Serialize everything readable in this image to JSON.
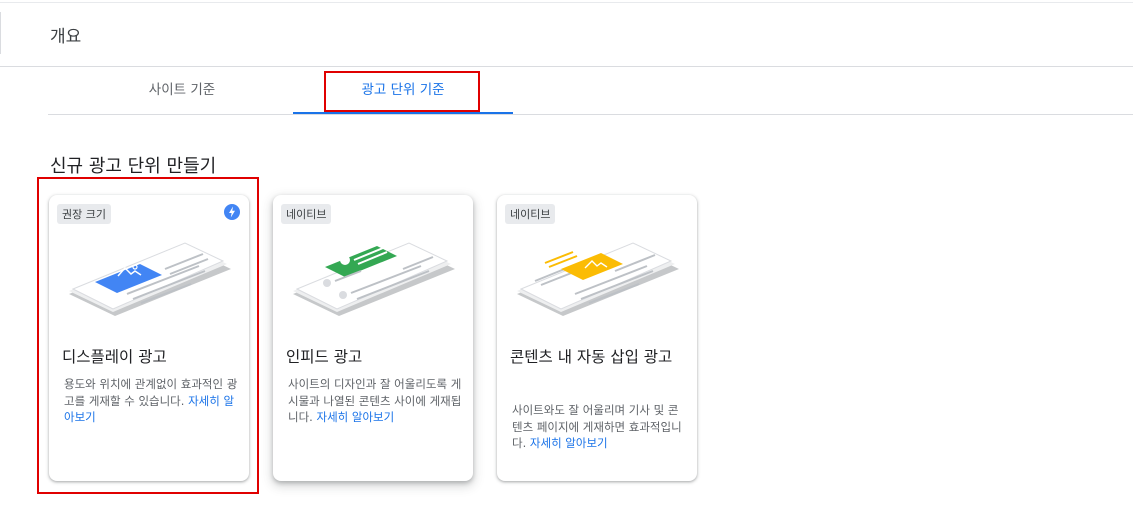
{
  "header": {
    "title": "개요"
  },
  "tabs": [
    {
      "label": "사이트 기준"
    },
    {
      "label": "광고 단위 기준"
    }
  ],
  "section": {
    "title": "신규 광고 단위 만들기"
  },
  "cards": [
    {
      "badge": "권장 크기",
      "title": "디스플레이 광고",
      "description": "용도와 위치에 관계없이 효과적인 광고를 게재할 수 있습니다.",
      "link": "자세히 알아보기",
      "icon": "display-ad-illustration",
      "accent": "#4285f4"
    },
    {
      "badge": "네이티브",
      "title": "인피드 광고",
      "description": "사이트의 디자인과 잘 어울리도록 게시물과 나열된 콘텐츠 사이에 게재됩니다.",
      "link": "자세히 알아보기",
      "icon": "infeed-ad-illustration",
      "accent": "#34a853"
    },
    {
      "badge": "네이티브",
      "title": "콘텐츠 내 자동 삽입 광고",
      "description": "사이트와도 잘 어울리며 기사 및 콘텐츠 페이지에 게재하면 효과적입니다.",
      "link": "자세히 알아보기",
      "icon": "in-article-ad-illustration",
      "accent": "#fbbc04"
    }
  ],
  "colors": {
    "primary": "#1a73e8",
    "highlight": "#e00000"
  }
}
